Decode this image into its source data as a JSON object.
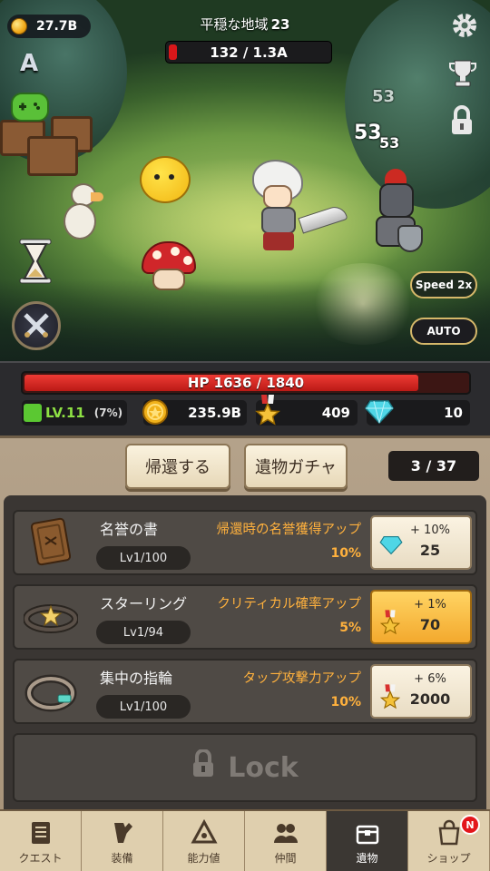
{
  "hud": {
    "gold": "27.7B",
    "stage_name": "平穏な地域",
    "stage_number": "23",
    "boss_hp": "132 / 1.3A",
    "boss_hp_fraction": 0.05,
    "speed_label": "Speed 2x",
    "auto_label": "AUTO",
    "damage_numbers": [
      "53",
      "53",
      "53"
    ]
  },
  "status": {
    "hp_text": "HP 1636 / 1840",
    "hp_fraction": 0.889,
    "level": "LV.11",
    "level_pct": "(7%)",
    "gold": "235.9B",
    "medals": "409",
    "gems": "10"
  },
  "relic_panel": {
    "return_label": "帰還する",
    "gacha_label": "遺物ガチャ",
    "count": "3 / 37",
    "relics": [
      {
        "name": "名誉の書",
        "level": "Lv1/100",
        "desc": "帰還時の名誉獲得アップ",
        "value": "10%",
        "increment": "+ 10%",
        "cost": "25",
        "cost_icon": "diamond-icon",
        "icon": "book-icon"
      },
      {
        "name": "スターリング",
        "level": "Lv1/94",
        "desc": "クリティカル確率アップ",
        "value": "5%",
        "increment": "+ 1%",
        "cost": "70",
        "cost_icon": "medal-icon",
        "icon": "star-ring-icon"
      },
      {
        "name": "集中の指輪",
        "level": "Lv1/100",
        "desc": "タップ攻撃力アップ",
        "value": "10%",
        "increment": "+ 6%",
        "cost": "2000",
        "cost_icon": "medal-icon",
        "icon": "ring-icon"
      }
    ],
    "lock_label": "Lock"
  },
  "nav": [
    {
      "label": "クエスト",
      "icon": "quest-icon"
    },
    {
      "label": "装備",
      "icon": "equipment-icon"
    },
    {
      "label": "能力値",
      "icon": "stats-icon"
    },
    {
      "label": "仲間",
      "icon": "companions-icon"
    },
    {
      "label": "遺物",
      "icon": "relic-chest-icon",
      "active": true
    },
    {
      "label": "ショップ",
      "icon": "shop-bag-icon",
      "badge": "N"
    }
  ],
  "colors": {
    "hp_red": "#d9171a",
    "level_green": "#8ee044",
    "accent_orange": "#ffb13d",
    "active_button": "#f3a92e"
  }
}
